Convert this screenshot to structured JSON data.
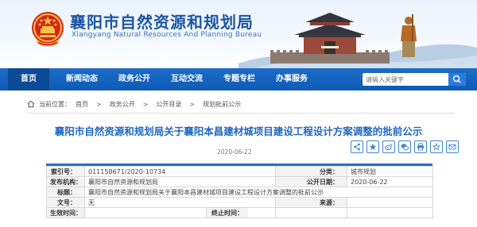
{
  "site": {
    "title_cn": "襄阳市自然资源和规划局",
    "title_en": "Xiangyang Natural Resources And Planning Bureau",
    "brand_color": "#1d56a3"
  },
  "nav": {
    "items": [
      {
        "label": "首页",
        "active": true
      },
      {
        "label": "新闻动态"
      },
      {
        "label": "政务公开"
      },
      {
        "label": "互动交流"
      },
      {
        "label": "专题专栏"
      },
      {
        "label": "办事服务"
      }
    ],
    "search_placeholder": "请输入关键字",
    "color": "#0f5bb5"
  },
  "breadcrumb": {
    "prefix": "当前位置：",
    "items": [
      "首页",
      "政务公开",
      "公开目录",
      "规划批前公示"
    ],
    "separator": ">"
  },
  "doc": {
    "title": "襄阳市自然资源和规划局关于襄阳本昌建材城项目建设工程设计方案调整的批前公示",
    "date_line": "2020-06-22",
    "share_icons": [
      "share-icon",
      "qzone-icon",
      "weibo-icon",
      "wechat-icon",
      "print-icon",
      "favorite-icon",
      "email-icon"
    ]
  },
  "meta": {
    "index_no_label": "索引号：",
    "index_no": "011158671/2020-10734",
    "category_label": "分类：",
    "category": "城市规划",
    "publisher_label": "发布机构：",
    "publisher": "襄阳市自然资源和规划局",
    "pub_date_label": "公开日期：",
    "pub_date": "2020-06-22",
    "title_label": "标题：",
    "title": "襄阳市自然资源和规划局关于襄阳本昌建材城项目建设工程设计方案调整的批前公示",
    "doc_no_label": "文号：",
    "doc_no": "无",
    "source_label": "来源：",
    "source": "",
    "effective_label": "生效时间：",
    "effective": "",
    "expiry_label": "终止时间：",
    "expiry": ""
  }
}
